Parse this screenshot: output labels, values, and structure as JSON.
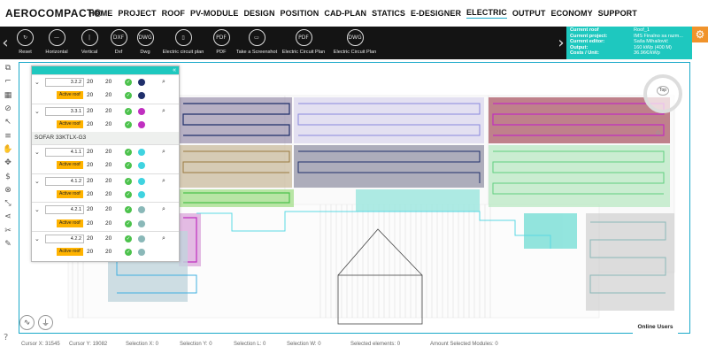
{
  "app": {
    "logo": "AEROCOMPACT®"
  },
  "nav": {
    "items": [
      "HOME",
      "PROJECT",
      "ROOF",
      "PV-MODULE",
      "DESIGN",
      "POSITION",
      "CAD-PLAN",
      "STATICS",
      "E-DESIGNER",
      "ELECTRIC",
      "OUTPUT",
      "ECONOMY",
      "SUPPORT"
    ],
    "active": "ELECTRIC"
  },
  "toolbar": {
    "buttons": [
      {
        "label": "Reset",
        "icon": "reset-icon",
        "glyph": "↻"
      },
      {
        "label": "Horizontal",
        "icon": "horizontal-icon",
        "glyph": "—"
      },
      {
        "label": "Vertical",
        "icon": "vertical-icon",
        "glyph": "|"
      },
      {
        "label": "Dxf",
        "icon": "dxf-icon",
        "glyph": "DXF"
      },
      {
        "label": "Dwg",
        "icon": "dwg-icon",
        "glyph": "DWG"
      },
      {
        "label": "Electric circuit plan",
        "icon": "electric-plan-icon",
        "glyph": "▯"
      },
      {
        "label": "PDF",
        "icon": "pdf-icon",
        "glyph": "PDF"
      },
      {
        "label": "Take a Screenshot",
        "icon": "screenshot-icon",
        "glyph": "▭"
      },
      {
        "label": "Electric Circuit Plan",
        "icon": "pdf-icon",
        "glyph": "PDF"
      },
      {
        "label": "Electric Circuit Plan",
        "icon": "dwg-icon",
        "glyph": "DWG"
      }
    ]
  },
  "project_info": {
    "rows": [
      {
        "key": "Current roof",
        "value": "Roof_1"
      },
      {
        "key": "Current project:",
        "value": "IMS Finalno sa razm..."
      },
      {
        "key": "Current editor:",
        "value": "Saša Mihailović"
      },
      {
        "key": "Output:",
        "value": "160 kWp (400 M)"
      },
      {
        "key": "Costs / Unit:",
        "value": "36.96€/kWp"
      }
    ]
  },
  "inverter_panel": {
    "rows": [
      {
        "id": "3.2.2",
        "a": "20",
        "b": "20",
        "badge": "Active roof",
        "color": "#1f2f6b"
      },
      {
        "id": "3.3.1",
        "a": "20",
        "b": "20",
        "badge": "Active roof",
        "color": "#c02fc0"
      },
      {
        "label": "SOFAR 33KTLX-G3"
      },
      {
        "id": "4.1.1",
        "a": "20",
        "b": "20",
        "badge": "Active roof",
        "color": "#3fd3e0"
      },
      {
        "id": "4.1.2",
        "a": "20",
        "b": "20",
        "badge": "Active roof",
        "color": "#3fd3e0"
      },
      {
        "id": "4.2.1",
        "a": "20",
        "b": "20",
        "badge": "Active roof",
        "color": "#8ab8b8"
      },
      {
        "id": "4.2.2",
        "a": "20",
        "b": "20",
        "badge": "Active roof",
        "color": "#8ab8b8"
      }
    ]
  },
  "compass": {
    "label": "Top"
  },
  "online_users": "Online Users",
  "status": {
    "cursor_x": "Cursor X: 31545",
    "cursor_y": "Cursor Y: 19082",
    "sel_x": "Selection X: 0",
    "sel_y": "Selection Y: 0",
    "sel_l": "Selection L: 0",
    "sel_w": "Selection W: 0",
    "selected_elements": "Selected elements: 0",
    "amount_selected": "Amount Selected Modules: 0"
  },
  "colors": {
    "accent": "#1aa9c9",
    "info_bg": "#1ec8bf",
    "gear": "#f0932b",
    "badge": "#ffb300"
  }
}
